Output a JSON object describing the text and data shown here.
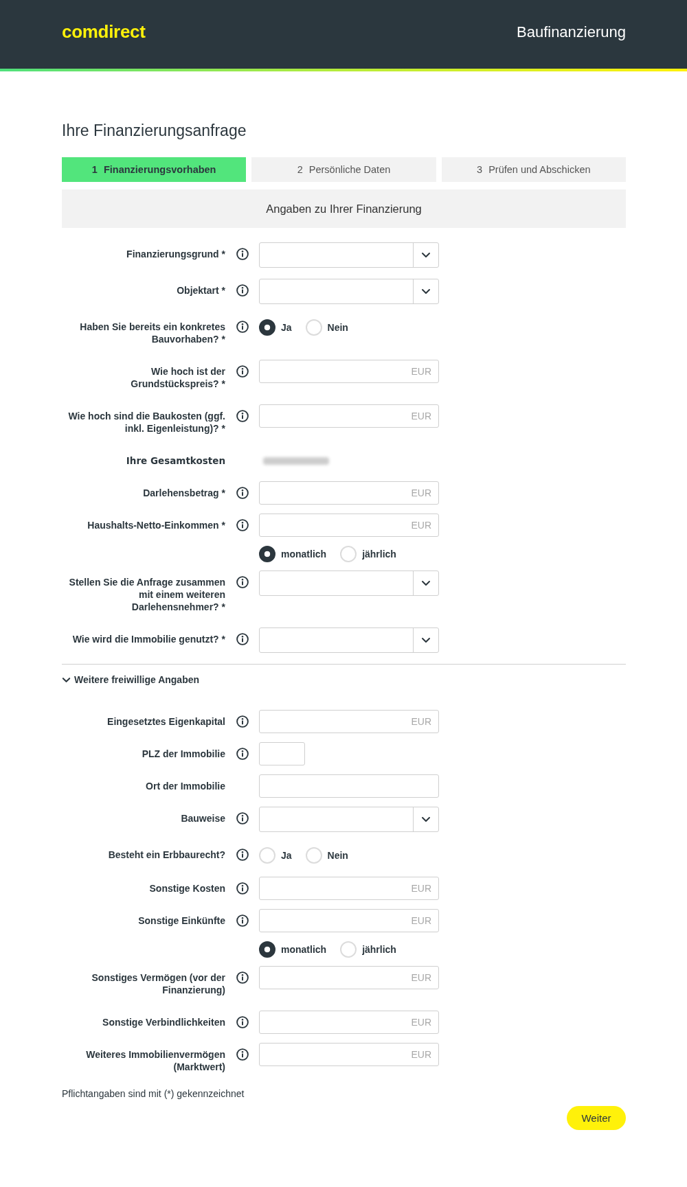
{
  "header": {
    "logo": "comdirect",
    "title": "Baufinanzierung"
  },
  "page_title": "Ihre Finanzierungsanfrage",
  "steps": [
    {
      "number": "1",
      "label": "Finanzierungsvorhaben",
      "selected": true
    },
    {
      "number": "2",
      "label": "Persönliche Daten",
      "selected": false
    },
    {
      "number": "3",
      "label": "Prüfen und Abschicken",
      "selected": false
    }
  ],
  "section_title": "Angaben zu Ihrer Finanzierung",
  "fields": [
    {
      "kind": "select",
      "label": "Finanzierungsgrund *",
      "info": true
    },
    {
      "kind": "select",
      "label": "Objektart *",
      "info": true
    },
    {
      "kind": "radio",
      "label": "Haben Sie bereits ein konkretes Bauvorhaben? *",
      "info": true,
      "options": [
        {
          "label": "Ja",
          "selected": true
        },
        {
          "label": "Nein",
          "selected": false
        }
      ]
    },
    {
      "kind": "input",
      "label": "Wie hoch ist der Grundstückspreis? *",
      "info": true,
      "placeholder": "EUR"
    },
    {
      "kind": "input",
      "label": "Wie hoch sind die Baukosten (ggf. inkl. Eigenleistung)? *",
      "info": true,
      "placeholder": "EUR"
    },
    {
      "kind": "total",
      "label": "Ihre Gesamtkosten",
      "info": false
    },
    {
      "kind": "input",
      "label": "Darlehensbetrag *",
      "info": true,
      "placeholder": "EUR"
    },
    {
      "kind": "input",
      "label": "Haushalts-Netto-Einkommen *",
      "info": true,
      "placeholder": "EUR"
    },
    {
      "kind": "radio",
      "info": false,
      "options": [
        {
          "label": "monatlich",
          "selected": true
        },
        {
          "label": "jährlich",
          "selected": false
        }
      ]
    },
    {
      "kind": "select",
      "label": "Stellen Sie die Anfrage zusammen mit einem weiteren Darlehensnehmer? *",
      "info": true
    },
    {
      "kind": "select",
      "label": "Wie wird die Immobilie genutzt? *",
      "info": true
    }
  ],
  "more_section": {
    "label": "Weitere freiwillige Angaben",
    "expanded": true,
    "fields": [
      {
        "kind": "input",
        "label": "Eingesetztes Eigenkapital",
        "info": true,
        "placeholder": "EUR"
      },
      {
        "kind": "short_input",
        "label": "PLZ der Immobilie",
        "info": true
      },
      {
        "kind": "input",
        "label": "Ort der Immobilie",
        "info": false
      },
      {
        "kind": "select",
        "label": "Bauweise",
        "info": true
      },
      {
        "kind": "radio",
        "label": "Besteht ein Erbbaurecht?",
        "info": true,
        "options": [
          {
            "label": "Ja",
            "selected": false
          },
          {
            "label": "Nein",
            "selected": false
          }
        ]
      },
      {
        "kind": "input",
        "label": "Sonstige Kosten",
        "info": true,
        "placeholder": "EUR"
      },
      {
        "kind": "input",
        "label": "Sonstige Einkünfte",
        "info": true,
        "placeholder": "EUR"
      },
      {
        "kind": "radio",
        "info": false,
        "options": [
          {
            "label": "monatlich",
            "selected": true
          },
          {
            "label": "jährlich",
            "selected": false
          }
        ]
      },
      {
        "kind": "input",
        "label": "Sonstiges Vermögen (vor der Finanzierung)",
        "info": true,
        "placeholder": "EUR"
      },
      {
        "kind": "input",
        "label": "Sonstige Verbindlichkeiten",
        "info": true,
        "placeholder": "EUR"
      },
      {
        "kind": "input",
        "label": "Weiteres Immobilienvermögen (Marktwert)",
        "info": true,
        "placeholder": "EUR"
      }
    ]
  },
  "footnote": "Pflichtangaben sind mit (*) gekennzeichnet",
  "next_button": "Weiter"
}
